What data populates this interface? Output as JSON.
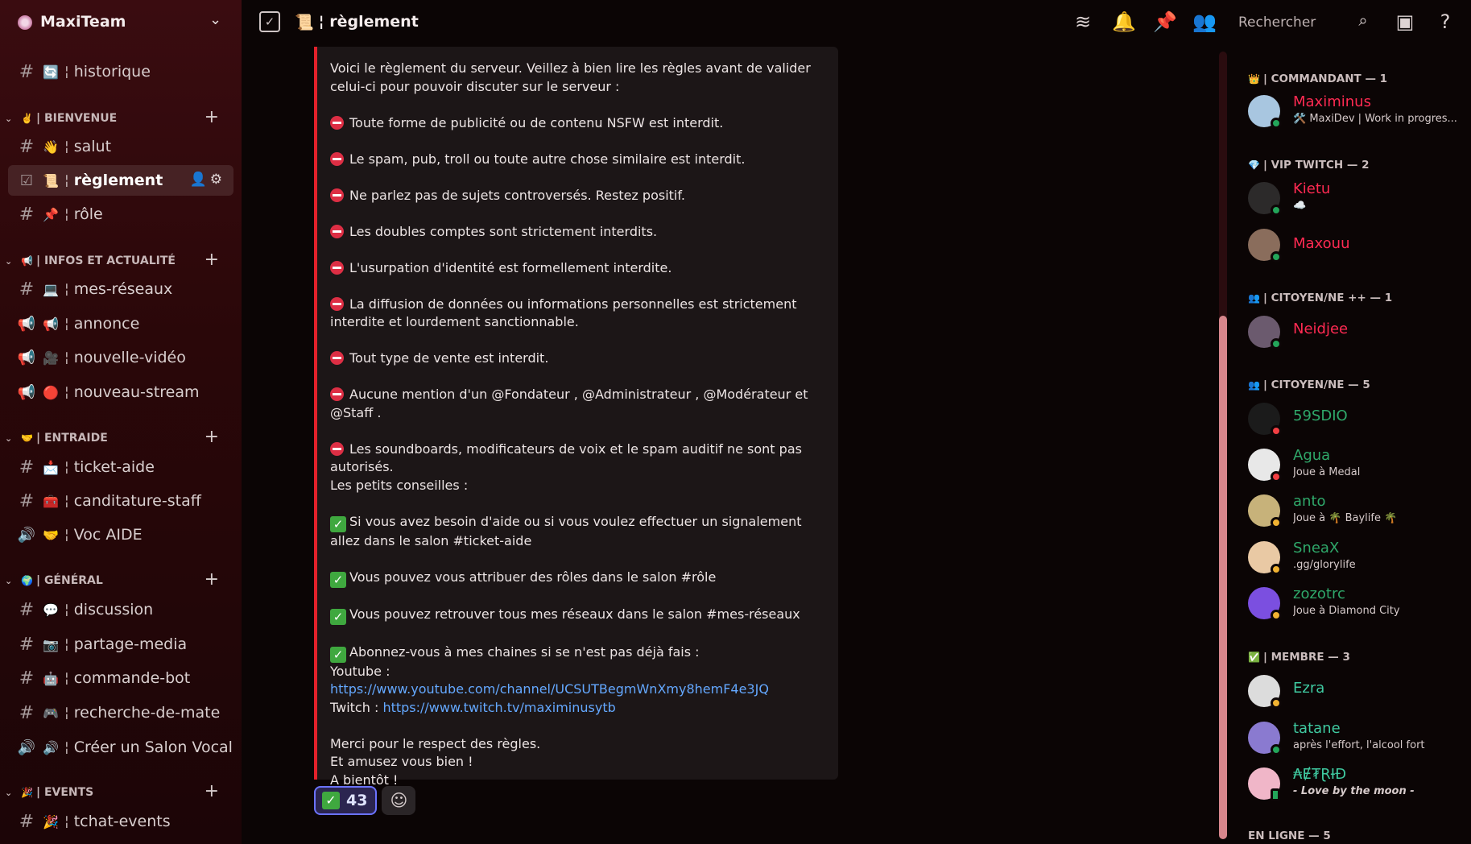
{
  "server": {
    "name": "MaxiTeam"
  },
  "channels": {
    "top": [
      {
        "emoji": "🔄",
        "label": "historique"
      }
    ],
    "categories": [
      {
        "emoji": "✌️",
        "label": "| BIENVENUE",
        "items": [
          {
            "emoji": "👋",
            "label": "salut"
          },
          {
            "emoji": "📜",
            "label": "règlement"
          },
          {
            "emoji": "📌",
            "label": "rôle"
          }
        ]
      },
      {
        "emoji": "📢",
        "label": "| INFOS ET ACTUALITÉ",
        "items": [
          {
            "emoji": "💻",
            "label": "mes-réseaux"
          },
          {
            "emoji": "📢",
            "label": "annonce"
          },
          {
            "emoji": "🎥",
            "label": "nouvelle-vidéo"
          },
          {
            "emoji": "🔴",
            "label": "nouveau-stream"
          }
        ]
      },
      {
        "emoji": "🤝",
        "label": "| ENTRAIDE",
        "items": [
          {
            "emoji": "📩",
            "label": "ticket-aide"
          },
          {
            "emoji": "🧰",
            "label": "canditature-staff"
          },
          {
            "emoji": "🤝",
            "label": "Voc AIDE"
          }
        ]
      },
      {
        "emoji": "🌍",
        "label": "| GÉNÉRAL",
        "items": [
          {
            "emoji": "💬",
            "label": "discussion"
          },
          {
            "emoji": "📷",
            "label": "partage-media"
          },
          {
            "emoji": "🤖",
            "label": "commande-bot"
          },
          {
            "emoji": "🎮",
            "label": "recherche-de-mate"
          },
          {
            "emoji": "🔊",
            "label": "Créer un Salon Vocal"
          }
        ]
      },
      {
        "emoji": "🎉",
        "label": "| EVENTS",
        "items": [
          {
            "emoji": "🎉",
            "label": "tchat-events"
          }
        ]
      }
    ]
  },
  "header": {
    "emoji": "📜",
    "title": "¦ règlement",
    "search_placeholder": "Rechercher"
  },
  "message": {
    "intro": "Voici le règlement du serveur. Veillez à bien lire les règles avant de valider celui-ci pour pouvoir discuter sur le serveur :",
    "rules": [
      "Toute forme de publicité ou de contenu NSFW est interdit.",
      "Le spam, pub, troll ou toute autre chose similaire est interdit.",
      "Ne parlez pas de sujets controversés. Restez positif.",
      "Les doubles comptes sont strictement interdits.",
      "L'usurpation d'identité est formellement interdite.",
      "La diffusion de données ou informations personnelles est strictement interdite et lourdement sanctionnable.",
      "Tout type de vente est interdit.",
      "Aucune mention d'un @Fondateur , @Administrateur , @Modérateur et @Staff .",
      "Les soundboards, modificateurs de voix et le spam auditif ne sont pas autorisés."
    ],
    "tips_title": "Les petits conseilles :",
    "tips": [
      "Si vous avez besoin d'aide ou si vous voulez effectuer un signalement allez dans le salon #ticket-aide",
      "Vous pouvez vous attribuer des rôles dans le salon #rôle",
      "Vous pouvez retrouver tous mes réseaux dans le salon #mes-réseaux",
      "Abonnez-vous à mes chaines si se n'est pas déjà fais :"
    ],
    "youtube_label": "Youtube : ",
    "youtube_url": "https://www.youtube.com/channel/UCSUTBegmWnXmy8hemF4e3JQ",
    "twitch_label": "Twitch : ",
    "twitch_url": "https://www.twitch.tv/maximinusytb",
    "outro": [
      "Merci pour le respect des règles.",
      "Et amusez vous bien !",
      "A bientôt !"
    ],
    "reaction_count": "43"
  },
  "members": {
    "groups": [
      {
        "emoji": "👑",
        "label": "| COMMANDANT — 1",
        "members": [
          {
            "name": "Maximinus",
            "color": "#ff2a52",
            "status": "online",
            "sub": "🛠️ MaxiDev | Work in progres...",
            "avatar": "#a8c6e0"
          }
        ]
      },
      {
        "emoji": "💎",
        "label": "| VIP TWITCH — 2",
        "members": [
          {
            "name": "Kietu",
            "color": "#ff2a52",
            "status": "online",
            "sub": "☁️",
            "avatar": "#2c2a2a"
          },
          {
            "name": "Maxouu",
            "color": "#ff2a52",
            "status": "online",
            "sub": "",
            "avatar": "#8a6d5c"
          }
        ]
      },
      {
        "emoji": "👥",
        "label": "| CITOYEN/NE ++ — 1",
        "members": [
          {
            "name": "Neidjee",
            "color": "#ff2a52",
            "status": "online",
            "sub": "",
            "avatar": "#6b5a6e"
          }
        ]
      },
      {
        "emoji": "👥",
        "label": "| CITOYEN/NE — 5",
        "members": [
          {
            "name": "59SDIO",
            "color": "#2fa86a",
            "status": "dnd",
            "sub": "",
            "avatar": "#1b1b1b"
          },
          {
            "name": "Agua",
            "color": "#2fa86a",
            "status": "dnd",
            "sub": "Joue à Medal",
            "avatar": "#e8e8e8"
          },
          {
            "name": "anto",
            "color": "#2fa86a",
            "status": "idle",
            "sub": "Joue à 🌴 Baylife 🌴",
            "avatar": "#c7b27a"
          },
          {
            "name": "SneaX",
            "color": "#2fa86a",
            "status": "idle",
            "sub": ".gg/glorylife",
            "avatar": "#e9c9a4"
          },
          {
            "name": "zozotrc",
            "color": "#2fa86a",
            "status": "idle",
            "sub": "Joue à Diamond City",
            "avatar": "#7b4fe0"
          }
        ]
      },
      {
        "emoji": "✅",
        "label": "| MEMBRE — 3",
        "members": [
          {
            "name": "Ezra",
            "color": "#3fc9a0",
            "status": "idle",
            "sub": "",
            "avatar": "#dcdcdc"
          },
          {
            "name": "tatane",
            "color": "#3fc9a0",
            "status": "online",
            "sub": "après l'effort, l'alcool fort",
            "avatar": "#8a7ad0"
          },
          {
            "name": "₳Ɇ₮ⱤƗĐ",
            "color": "#3fc9a0",
            "status": "mobile",
            "sub": "- Love by the moon -",
            "avatar": "#f0b6c8"
          }
        ]
      }
    ],
    "online_label": "EN LIGNE — 5"
  },
  "colors": {
    "accent_red": "#e3212b",
    "link": "#64a8ff",
    "reaction_border": "#6b73ff"
  }
}
